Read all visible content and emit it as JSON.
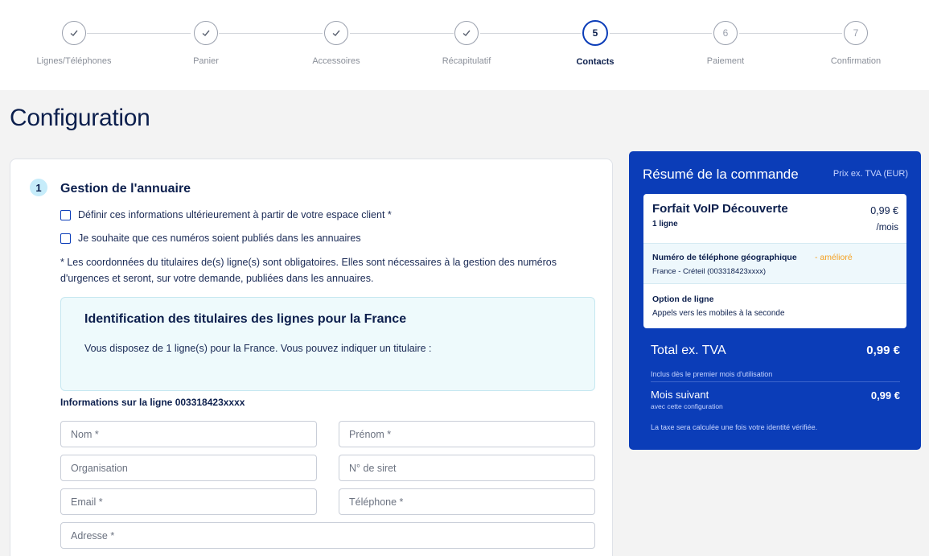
{
  "stepper": {
    "steps": [
      {
        "label": "Lignes/Téléphones",
        "state": "done",
        "number": ""
      },
      {
        "label": "Panier",
        "state": "done",
        "number": ""
      },
      {
        "label": "Accessoires",
        "state": "done",
        "number": ""
      },
      {
        "label": "Récapitulatif",
        "state": "done",
        "number": ""
      },
      {
        "label": "Contacts",
        "state": "active",
        "number": "5"
      },
      {
        "label": "Paiement",
        "state": "todo",
        "number": "6"
      },
      {
        "label": "Confirmation",
        "state": "todo",
        "number": "7"
      }
    ]
  },
  "page": {
    "title": "Configuration"
  },
  "directory": {
    "number": "1",
    "title": "Gestion de l'annuaire",
    "checkbox_later": "Définir ces informations ultérieurement à partir de votre espace client *",
    "checkbox_publish": "Je souhaite que ces numéros soient publiés dans les annuaires",
    "note": "* Les coordonnées du titulaires de(s) ligne(s) sont obligatoires. Elles sont nécessaires à la gestion des numéros d'urgences et seront, sur votre demande, publiées dans les annuaires.",
    "id_box": {
      "title": "Identification des titulaires des lignes pour la France",
      "description": "Vous disposez de 1 ligne(s) pour la France. Vous pouvez indiquer un titulaire :"
    },
    "line_info": "Informations sur la ligne 003318423xxxx",
    "fields": {
      "nom": "Nom *",
      "prenom": "Prénom *",
      "organisation": "Organisation",
      "siret": "N° de siret",
      "email": "Email *",
      "telephone": "Téléphone *",
      "adresse": "Adresse *"
    }
  },
  "summary": {
    "title": "Résumé de la commande",
    "price_note": "Prix ex. TVA (EUR)",
    "plan_name": "Forfait VoIP Découverte",
    "plan_lines": "1 ligne",
    "plan_price": "0,99 €",
    "plan_period": "/mois",
    "number_label": "Numéro de téléphone géographique",
    "number_badge": "- amélioré",
    "number_sub": "France - Créteil (003318423xxxx)",
    "option_label": "Option de ligne",
    "option_sub": "Appels vers les mobiles à la seconde",
    "total_label": "Total ex. TVA",
    "total_value": "0,99 €",
    "included_note": "Inclus dès le premier mois d'utilisation",
    "next_label": "Mois suivant",
    "next_sub": "avec cette configuration",
    "next_value": "0,99 €",
    "tax_note": "La taxe sera calculée une fois votre identité vérifiée."
  },
  "colors": {
    "brand_blue": "#0b3db8",
    "accent_orange": "#f5a020",
    "navy_text": "#0c1f4d"
  }
}
